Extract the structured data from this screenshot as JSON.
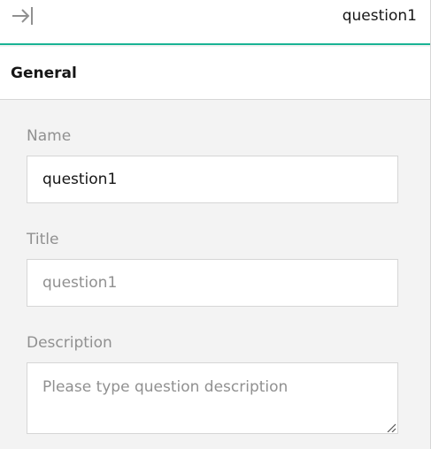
{
  "topbar": {
    "collapse_icon": "collapse-right-icon",
    "title": "question1",
    "accent": "#19b394"
  },
  "section": {
    "title": "General"
  },
  "fields": {
    "name": {
      "label": "Name",
      "value": "question1"
    },
    "title": {
      "label": "Title",
      "placeholder": "question1"
    },
    "description": {
      "label": "Description",
      "placeholder": "Please type question description"
    }
  }
}
